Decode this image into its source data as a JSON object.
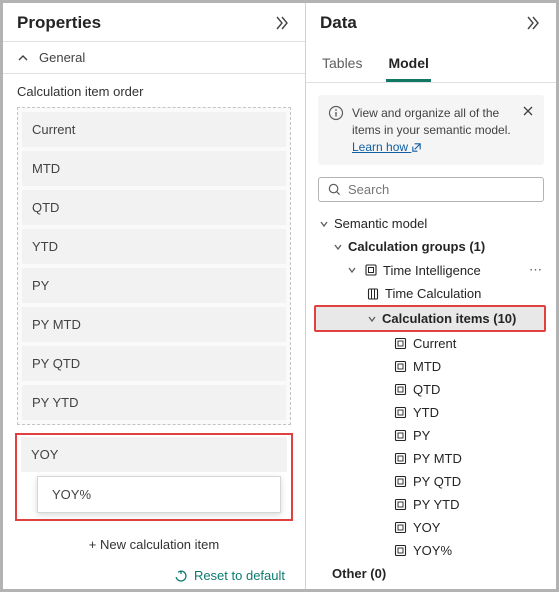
{
  "properties": {
    "title": "Properties",
    "general_label": "General",
    "field_label": "Calculation item order",
    "items": [
      "Current",
      "MTD",
      "QTD",
      "YTD",
      "PY",
      "PY MTD",
      "PY QTD",
      "PY YTD"
    ],
    "highlight_item": "YOY",
    "dragging_item": "YOY%",
    "new_item_label": "+ New calculation item",
    "reset_label": "Reset to default"
  },
  "data": {
    "title": "Data",
    "tabs": {
      "tables": "Tables",
      "model": "Model"
    },
    "info_text": "View and organize all of the items in your semantic model. ",
    "info_link": "Learn how",
    "search_placeholder": "Search",
    "tree": {
      "root": "Semantic model",
      "group_label": "Calculation groups (1)",
      "group_name": "Time Intelligence",
      "column_name": "Time Calculation",
      "items_label": "Calculation items (10)",
      "items": [
        "Current",
        "MTD",
        "QTD",
        "YTD",
        "PY",
        "PY MTD",
        "PY QTD",
        "PY YTD",
        "YOY",
        "YOY%"
      ],
      "other_label": "Other (0)"
    }
  }
}
